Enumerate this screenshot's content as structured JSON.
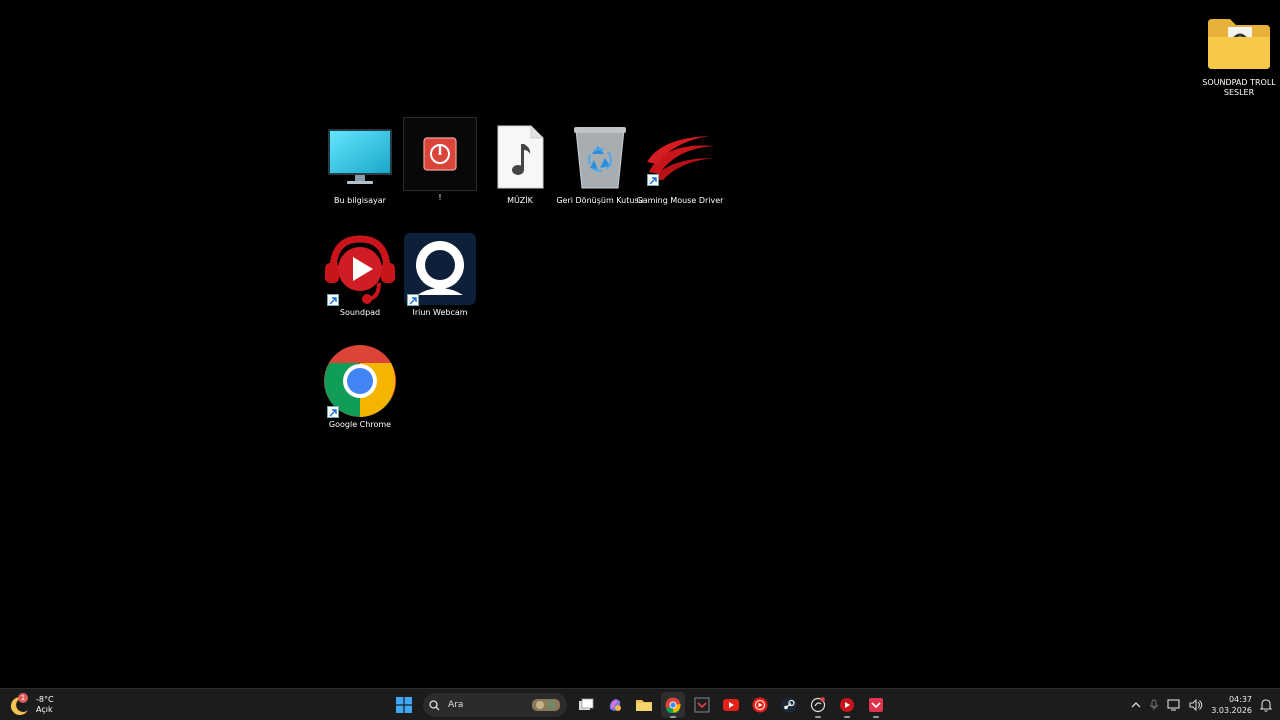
{
  "desktop": {
    "icons": [
      {
        "label": "Bu bilgisayar",
        "icon": "monitor-icon"
      },
      {
        "label": "!",
        "icon": "power-icon"
      },
      {
        "label": "MÜZİK",
        "icon": "music-file-icon"
      },
      {
        "label": "Geri Dönüşüm Kutusu",
        "icon": "recycle-bin-icon"
      },
      {
        "label": "Gaming Mouse Driver",
        "icon": "claw-logo-icon"
      },
      {
        "label": "Soundpad",
        "icon": "soundpad-icon"
      },
      {
        "label": "Iriun Webcam",
        "icon": "webcam-icon"
      },
      {
        "label": "Google Chrome",
        "icon": "chrome-icon"
      },
      {
        "label": "SOUNDPAD TROLL SESLER",
        "icon": "folder-icon"
      }
    ]
  },
  "taskbar": {
    "weather": {
      "temp": "-8°C",
      "condition": "Açık",
      "badge": "1"
    },
    "search_placeholder": "Ara",
    "apps": [
      "start-icon",
      "task-view-icon",
      "copilot-icon",
      "file-explorer-icon",
      "chrome-icon",
      "vscode-like-icon",
      "youtube-icon",
      "youtube-music-icon",
      "steam-icon",
      "gaming-mouse-icon",
      "soundpad-icon",
      "red-app-icon"
    ],
    "clock": {
      "time": "04:37",
      "date": "3.03.2026"
    }
  },
  "colors": {
    "taskbar_bg": "#1c1c1c",
    "accent": "#0078d4",
    "desktop_bg": "#000000"
  }
}
